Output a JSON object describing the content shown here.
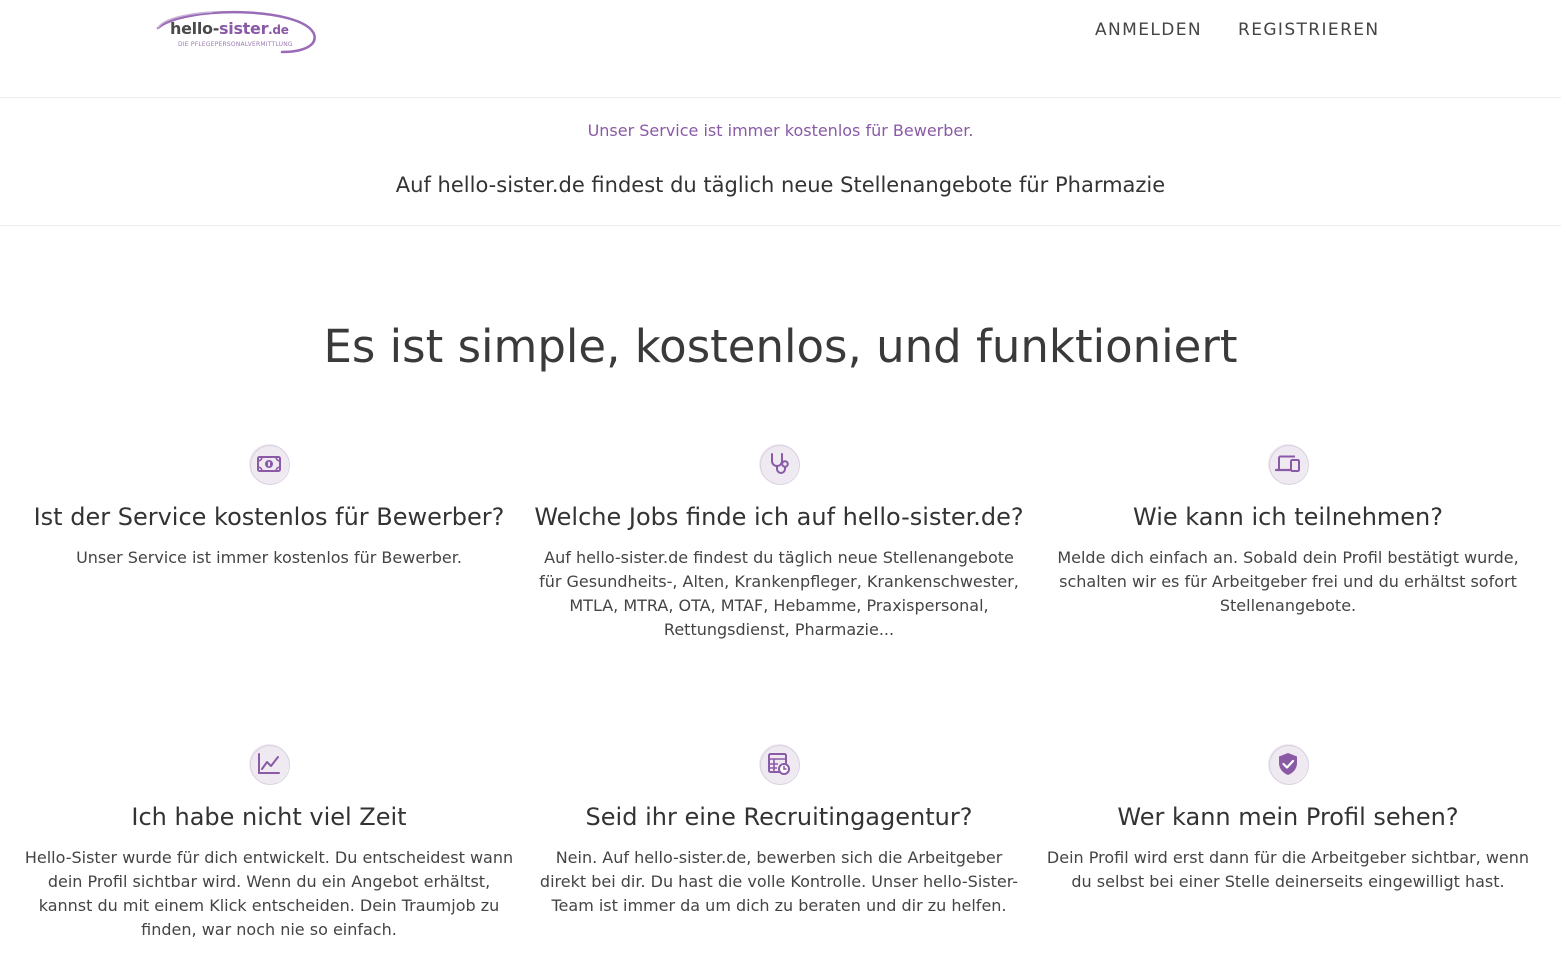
{
  "header": {
    "logo": {
      "name_main": "hello-",
      "name_accent": "sister",
      "name_tld": ".de",
      "tagline": "DIE PFLEGEPERSONALVERMITTLUNG"
    },
    "nav": {
      "login_label": "ANMELDEN",
      "register_label": "REGISTRIEREN"
    }
  },
  "strip": {
    "tagline": "Unser Service ist immer kostenlos für Bewerber.",
    "headline": "Auf hello-sister.de findest du täglich neue Stellenangebote für Pharmazie"
  },
  "main": {
    "title": "Es ist simple, kostenlos, und funktioniert",
    "features": [
      {
        "icon": "money-icon",
        "title": "Ist der Service kostenlos für Bewerber?",
        "text": "Unser Service ist immer kostenlos für Bewerber."
      },
      {
        "icon": "stethoscope-icon",
        "title": "Welche Jobs finde ich auf hello-sister.de?",
        "text": "Auf hello-sister.de findest du täglich neue Stellenangebote für Gesundheits-, Alten, Krankenpfleger, Krankenschwester, MTLA, MTRA, OTA, MTAF, Hebamme, Praxispersonal, Rettungsdienst, Pharmazie..."
      },
      {
        "icon": "devices-icon",
        "title": "Wie kann ich teilnehmen?",
        "text": "Melde dich einfach an. Sobald dein Profil bestätigt wurde, schalten wir es für Arbeitgeber frei und du erhältst sofort Stellenangebote."
      },
      {
        "icon": "chart-line-icon",
        "title": "Ich habe nicht viel Zeit",
        "text": "Hello-Sister wurde für dich entwickelt. Du entscheidest wann dein Profil sichtbar wird. Wenn du ein Angebot erhältst, kannst du mit einem Klick entscheiden. Dein Traumjob zu finden, war noch nie so einfach."
      },
      {
        "icon": "schedule-icon",
        "title": "Seid ihr eine Recruitingagentur?",
        "text": "Nein. Auf hello-sister.de, bewerben sich die Arbeitgeber direkt bei dir. Du hast die volle Kontrolle. Unser hello-Sister-Team ist immer da um dich zu beraten und dir zu helfen."
      },
      {
        "icon": "shield-check-icon",
        "title": "Wer kann mein Profil sehen?",
        "text": "Dein Profil wird erst dann für die Arbeitgeber sichtbar, wenn du selbst bei einer Stelle deinerseits eingewilligt hast."
      }
    ]
  },
  "colors": {
    "accent": "#8a5aa6",
    "icon_bg": "#efeaf2",
    "text": "#333333",
    "divider": "#ececec"
  }
}
